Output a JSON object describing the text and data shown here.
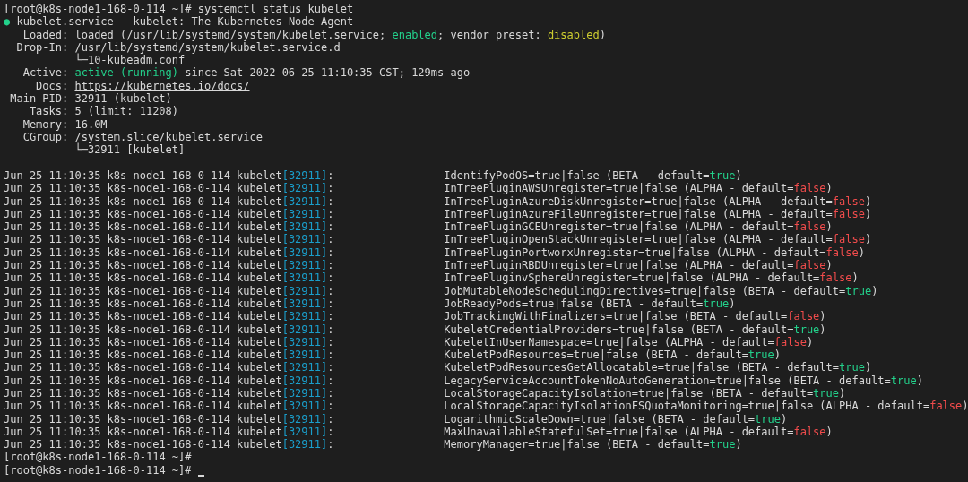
{
  "prompt": {
    "text": "[root@k8s-node1-168-0-114 ~]#",
    "command": "systemctl status kubelet"
  },
  "unit": {
    "dot": "●",
    "active": true,
    "title": "kubelet.service - kubelet: The Kubernetes Node Agent"
  },
  "status_lines": [
    {
      "label": "Loaded:",
      "value": [
        {
          "text": "loaded (/usr/lib/systemd/system/kubelet.service; ",
          "kind": "plain"
        },
        {
          "text": "enabled",
          "kind": "on"
        },
        {
          "text": "; vendor preset: ",
          "kind": "plain"
        },
        {
          "text": "disabled",
          "kind": "warn"
        },
        {
          "text": ")",
          "kind": "plain"
        }
      ]
    },
    {
      "label": "Drop-In:",
      "value": [
        {
          "text": "/usr/lib/systemd/system/kubelet.service.d",
          "kind": "plain"
        }
      ]
    },
    {
      "value": [
        {
          "text": "└─10-kubeadm.conf",
          "kind": "plain"
        }
      ]
    },
    {
      "label": "Active:",
      "value": [
        {
          "text": "active (running)",
          "kind": "on"
        },
        {
          "text": " since Sat 2022-06-25 11:10:35 CST; 129ms ago",
          "kind": "plain"
        }
      ]
    },
    {
      "label": "Docs:",
      "value": [
        {
          "text": "https://kubernetes.io/docs/",
          "kind": "link"
        }
      ]
    },
    {
      "label": "Main PID:",
      "value": [
        {
          "text": "32911 (kubelet)",
          "kind": "plain"
        }
      ]
    },
    {
      "label": "Tasks:",
      "value": [
        {
          "text": "5 (limit: 11208)",
          "kind": "plain"
        }
      ]
    },
    {
      "label": "Memory:",
      "value": [
        {
          "text": "16.0M",
          "kind": "plain"
        }
      ]
    },
    {
      "label": "CGroup:",
      "value": [
        {
          "text": "/system.slice/kubelet.service",
          "kind": "plain"
        }
      ]
    },
    {
      "value": [
        {
          "text": "└─32911 [kubelet]",
          "kind": "plain"
        }
      ]
    }
  ],
  "log_lines": [
    {
      "time": "Jun 25 11:10:35 k8s-node1-168-0-114 kubelet",
      "pid": "[32911]",
      "sep": ":",
      "message": "IdentifyPodOS=true|false (BETA - default=",
      "default": "true",
      "default_on": true,
      "close": ")"
    },
    {
      "time": "Jun 25 11:10:35 k8s-node1-168-0-114 kubelet",
      "pid": "[32911]",
      "sep": ":",
      "message": "InTreePluginAWSUnregister=true|false (ALPHA - default=",
      "default": "false",
      "default_on": false,
      "close": ")"
    },
    {
      "time": "Jun 25 11:10:35 k8s-node1-168-0-114 kubelet",
      "pid": "[32911]",
      "sep": ":",
      "message": "InTreePluginAzureDiskUnregister=true|false (ALPHA - default=",
      "default": "false",
      "default_on": false,
      "close": ")"
    },
    {
      "time": "Jun 25 11:10:35 k8s-node1-168-0-114 kubelet",
      "pid": "[32911]",
      "sep": ":",
      "message": "InTreePluginAzureFileUnregister=true|false (ALPHA - default=",
      "default": "false",
      "default_on": false,
      "close": ")"
    },
    {
      "time": "Jun 25 11:10:35 k8s-node1-168-0-114 kubelet",
      "pid": "[32911]",
      "sep": ":",
      "message": "InTreePluginGCEUnregister=true|false (ALPHA - default=",
      "default": "false",
      "default_on": false,
      "close": ")"
    },
    {
      "time": "Jun 25 11:10:35 k8s-node1-168-0-114 kubelet",
      "pid": "[32911]",
      "sep": ":",
      "message": "InTreePluginOpenStackUnregister=true|false (ALPHA - default=",
      "default": "false",
      "default_on": false,
      "close": ")"
    },
    {
      "time": "Jun 25 11:10:35 k8s-node1-168-0-114 kubelet",
      "pid": "[32911]",
      "sep": ":",
      "message": "InTreePluginPortworxUnregister=true|false (ALPHA - default=",
      "default": "false",
      "default_on": false,
      "close": ")"
    },
    {
      "time": "Jun 25 11:10:35 k8s-node1-168-0-114 kubelet",
      "pid": "[32911]",
      "sep": ":",
      "message": "InTreePluginRBDUnregister=true|false (ALPHA - default=",
      "default": "false",
      "default_on": false,
      "close": ")"
    },
    {
      "time": "Jun 25 11:10:35 k8s-node1-168-0-114 kubelet",
      "pid": "[32911]",
      "sep": ":",
      "message": "InTreePluginvSphereUnregister=true|false (ALPHA - default=",
      "default": "false",
      "default_on": false,
      "close": ")"
    },
    {
      "time": "Jun 25 11:10:35 k8s-node1-168-0-114 kubelet",
      "pid": "[32911]",
      "sep": ":",
      "message": "JobMutableNodeSchedulingDirectives=true|false (BETA - default=",
      "default": "true",
      "default_on": true,
      "close": ")"
    },
    {
      "time": "Jun 25 11:10:35 k8s-node1-168-0-114 kubelet",
      "pid": "[32911]",
      "sep": ":",
      "message": "JobReadyPods=true|false (BETA - default=",
      "default": "true",
      "default_on": true,
      "close": ")"
    },
    {
      "time": "Jun 25 11:10:35 k8s-node1-168-0-114 kubelet",
      "pid": "[32911]",
      "sep": ":",
      "message": "JobTrackingWithFinalizers=true|false (BETA - default=",
      "default": "false",
      "default_on": false,
      "close": ")"
    },
    {
      "time": "Jun 25 11:10:35 k8s-node1-168-0-114 kubelet",
      "pid": "[32911]",
      "sep": ":",
      "message": "KubeletCredentialProviders=true|false (BETA - default=",
      "default": "true",
      "default_on": true,
      "close": ")"
    },
    {
      "time": "Jun 25 11:10:35 k8s-node1-168-0-114 kubelet",
      "pid": "[32911]",
      "sep": ":",
      "message": "KubeletInUserNamespace=true|false (ALPHA - default=",
      "default": "false",
      "default_on": false,
      "close": ")"
    },
    {
      "time": "Jun 25 11:10:35 k8s-node1-168-0-114 kubelet",
      "pid": "[32911]",
      "sep": ":",
      "message": "KubeletPodResources=true|false (BETA - default=",
      "default": "true",
      "default_on": true,
      "close": ")"
    },
    {
      "time": "Jun 25 11:10:35 k8s-node1-168-0-114 kubelet",
      "pid": "[32911]",
      "sep": ":",
      "message": "KubeletPodResourcesGetAllocatable=true|false (BETA - default=",
      "default": "true",
      "default_on": true,
      "close": ")"
    },
    {
      "time": "Jun 25 11:10:35 k8s-node1-168-0-114 kubelet",
      "pid": "[32911]",
      "sep": ":",
      "message": "LegacyServiceAccountTokenNoAutoGeneration=true|false (BETA - default=",
      "default": "true",
      "default_on": true,
      "close": ")"
    },
    {
      "time": "Jun 25 11:10:35 k8s-node1-168-0-114 kubelet",
      "pid": "[32911]",
      "sep": ":",
      "message": "LocalStorageCapacityIsolation=true|false (BETA - default=",
      "default": "true",
      "default_on": true,
      "close": ")"
    },
    {
      "time": "Jun 25 11:10:35 k8s-node1-168-0-114 kubelet",
      "pid": "[32911]",
      "sep": ":",
      "message": "LocalStorageCapacityIsolationFSQuotaMonitoring=true|false (ALPHA - default=",
      "default": "false",
      "default_on": false,
      "close": ")"
    },
    {
      "time": "Jun 25 11:10:35 k8s-node1-168-0-114 kubelet",
      "pid": "[32911]",
      "sep": ":",
      "message": "LogarithmicScaleDown=true|false (BETA - default=",
      "default": "true",
      "default_on": true,
      "close": ")"
    },
    {
      "time": "Jun 25 11:10:35 k8s-node1-168-0-114 kubelet",
      "pid": "[32911]",
      "sep": ":",
      "message": "MaxUnavailableStatefulSet=true|false (ALPHA - default=",
      "default": "false",
      "default_on": false,
      "close": ")"
    },
    {
      "time": "Jun 25 11:10:35 k8s-node1-168-0-114 kubelet",
      "pid": "[32911]",
      "sep": ":",
      "message": "MemoryManager=true|false (BETA - default=",
      "default": "true",
      "default_on": true,
      "close": ")"
    }
  ],
  "end_prompts": [
    {
      "text": "[root@k8s-node1-168-0-114 ~]#",
      "cursor": false
    },
    {
      "text": "[root@k8s-node1-168-0-114 ~]#",
      "cursor": true
    }
  ]
}
